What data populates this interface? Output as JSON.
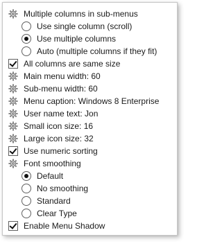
{
  "menu": {
    "items": [
      {
        "label": "Multiple columns in sub-menus",
        "icon": "gear-icon",
        "level": 0
      },
      {
        "label": "Use single column (scroll)",
        "icon": "radio-off",
        "level": 1
      },
      {
        "label": "Use multiple columns",
        "icon": "radio-on",
        "level": 1
      },
      {
        "label": "Auto (multiple columns if they fit)",
        "icon": "radio-off",
        "level": 1
      },
      {
        "label": "All columns are same size",
        "icon": "checkbox-checked",
        "level": 0
      },
      {
        "label": "Main menu width: 60",
        "icon": "gear-icon",
        "level": 0
      },
      {
        "label": "Sub-menu width: 60",
        "icon": "gear-icon",
        "level": 0
      },
      {
        "label": "Menu caption: Windows 8 Enterprise",
        "icon": "gear-icon",
        "level": 0
      },
      {
        "label": "User name text: Jon",
        "icon": "gear-icon",
        "level": 0
      },
      {
        "label": "Small icon size: 16",
        "icon": "gear-icon",
        "level": 0
      },
      {
        "label": "Large icon size: 32",
        "icon": "gear-icon",
        "level": 0
      },
      {
        "label": "Use numeric sorting",
        "icon": "checkbox-checked",
        "level": 0
      },
      {
        "label": "Font smoothing",
        "icon": "gear-icon",
        "level": 0
      },
      {
        "label": "Default",
        "icon": "radio-on",
        "level": 1
      },
      {
        "label": "No smoothing",
        "icon": "radio-off",
        "level": 1
      },
      {
        "label": "Standard",
        "icon": "radio-off",
        "level": 1
      },
      {
        "label": "Clear Type",
        "icon": "radio-off",
        "level": 1
      },
      {
        "label": "Enable Menu Shadow",
        "icon": "checkbox-checked",
        "level": 0
      }
    ]
  }
}
